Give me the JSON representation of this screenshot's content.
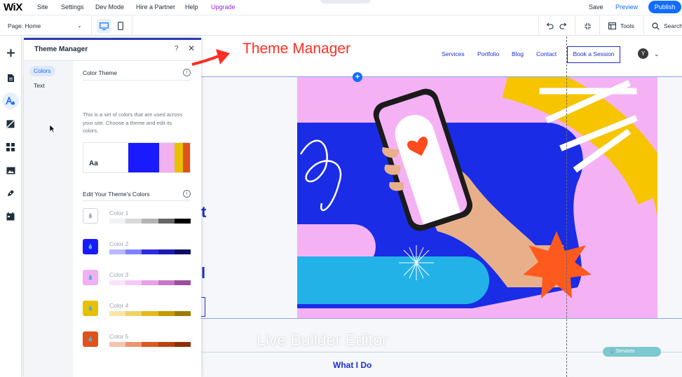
{
  "topbar": {
    "logo": "WiX",
    "menu": [
      "Site",
      "Settings",
      "Dev Mode",
      "Hire a Partner",
      "Help"
    ],
    "upgrade": "Upgrade",
    "save": "Save",
    "preview": "Preview",
    "publish": "Publish"
  },
  "toolbar": {
    "page_label": "Page: Home",
    "tools": "Tools",
    "search": "Search"
  },
  "site": {
    "nav": [
      "Services",
      "Portfolio",
      "Blog",
      "Contact"
    ],
    "book_button": "Book a Session",
    "avatar": "Y",
    "section_title": "What I Do",
    "services_tag": "Services"
  },
  "panel": {
    "title": "Theme Manager",
    "help": "?",
    "close": "✕",
    "tabs": [
      "Colors",
      "Text"
    ],
    "color_theme_heading": "Color Theme",
    "description": "This is a set of colors that are used across your site. Choose a theme and edit its colors.",
    "preview_text": "Aa",
    "edit_heading": "Edit Your Theme's Colors",
    "colors": [
      {
        "label": "Color 1",
        "swatch": "#ffffff",
        "shades": [
          "#f2f2f2",
          "#d9d9d9",
          "#b3b3b3",
          "#666666",
          "#000000"
        ]
      },
      {
        "label": "Color 2",
        "swatch": "#1a1aff",
        "shades": [
          "#b8b8ff",
          "#8080ff",
          "#2b2be0",
          "#1a1ab3",
          "#0d0d66"
        ]
      },
      {
        "label": "Color 3",
        "swatch": "#f2b0f2",
        "shades": [
          "#fbe3fb",
          "#f6c8f6",
          "#e9a0e9",
          "#c777c7",
          "#9c4f9c"
        ]
      },
      {
        "label": "Color 4",
        "swatch": "#e8c000",
        "shades": [
          "#f7e6a6",
          "#efd366",
          "#e4b91a",
          "#c49b00",
          "#9c7a00"
        ]
      },
      {
        "label": "Color 5",
        "swatch": "#e0521a",
        "shades": [
          "#f5c4ae",
          "#eb9570",
          "#dc5a20",
          "#b8420f",
          "#8a2f07"
        ]
      }
    ],
    "theme_preview_colors": [
      "#1a1aff",
      "#f2b0f2",
      "#e8c000",
      "#e0521a"
    ]
  },
  "captions": {
    "theme_manager": "Theme Manager",
    "live_builder": "Live Builder Editor"
  },
  "colors": {
    "accent": "#116dff",
    "site_blue": "#1b2ed1",
    "annotation_red": "#ff2e24"
  }
}
